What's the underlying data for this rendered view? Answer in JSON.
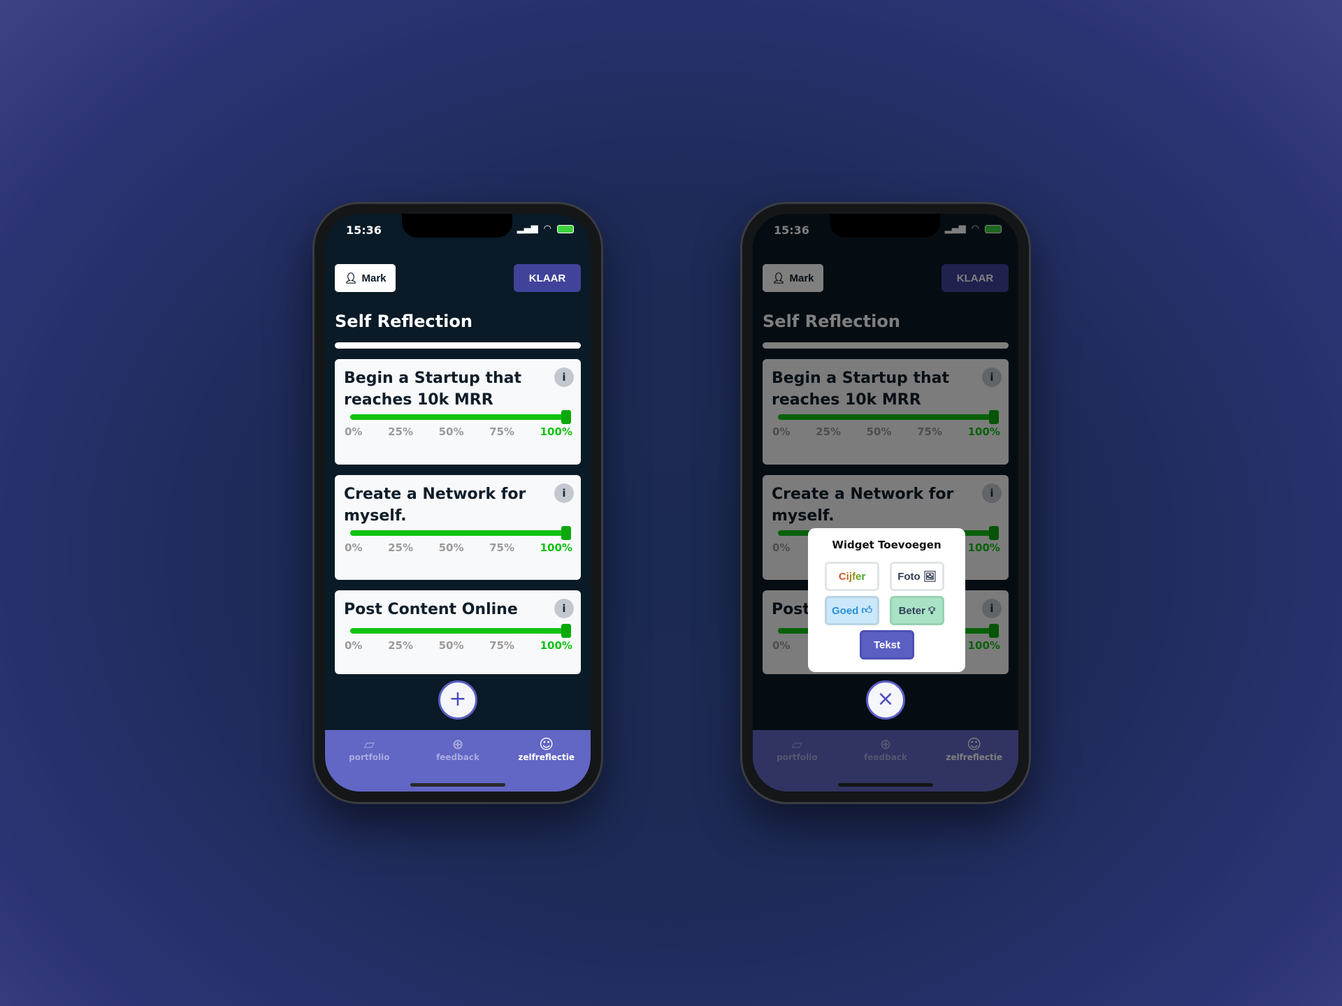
{
  "status": {
    "time": "15:36"
  },
  "header": {
    "user_label": "Mark",
    "done_label": "KLAAR"
  },
  "page_title": "Self Reflection",
  "overall_progress": 1.0,
  "ticks": [
    "0%",
    "25%",
    "50%",
    "75%",
    "100%"
  ],
  "goals": [
    {
      "title": "Begin a Startup that reaches 10k MRR",
      "value_percent": 100
    },
    {
      "title": "Create a Network for myself.",
      "value_percent": 100
    },
    {
      "title": "Post Content Online",
      "value_percent": 100
    }
  ],
  "info_label": "i",
  "fab": {
    "add_icon": "+",
    "close_icon": "×"
  },
  "tabs": [
    {
      "label": "portfolio",
      "icon": "note-icon"
    },
    {
      "label": "feedback",
      "icon": "plus-circle-icon"
    },
    {
      "label": "zelfreflectie",
      "icon": "smiley-icon",
      "active": true
    }
  ],
  "popup": {
    "title": "Widget Toevoegen",
    "buttons": [
      "Cijfer",
      "Foto",
      "Goed",
      "Beter",
      "Tekst"
    ]
  },
  "colors": {
    "accent": "#41439a",
    "tabbar": "#6266c4",
    "progress": "#12c212",
    "background": "#0a1a26"
  }
}
